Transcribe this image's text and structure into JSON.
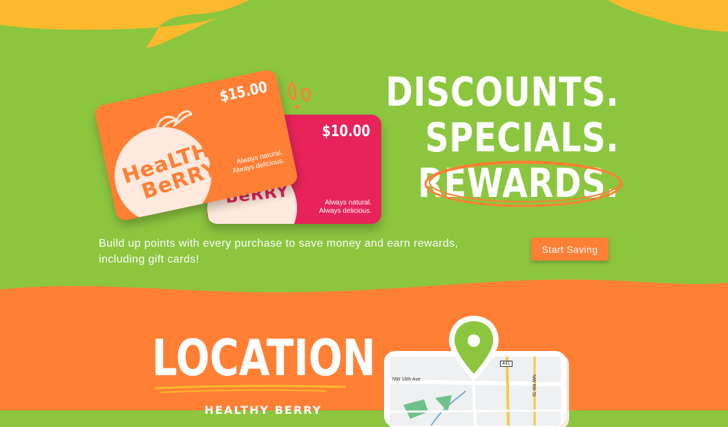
{
  "headline": {
    "line1": "DISCOUNTS.",
    "line2": "SPECIALS.",
    "line3": "REWARDS."
  },
  "cards": {
    "orange": {
      "amount": "$15.00",
      "tagline1": "Always natural.",
      "tagline2": "Always delicious.",
      "logo_line1": "HeaLTHY",
      "logo_line2": "BeRRY"
    },
    "pink": {
      "amount": "$10.00",
      "tagline1": "Always natural.",
      "tagline2": "Always delicious.",
      "logo_text": "BeRRY"
    }
  },
  "promo": {
    "text": "Build up points with every purchase to save money and earn rewards, including gift cards!",
    "button_label": "Start Saving"
  },
  "location": {
    "title": "LOCATION",
    "subtitle": "HEALTHY BERRY"
  },
  "map": {
    "road1": "NW 16th Ave",
    "road2": "NW 6th St",
    "highway": "441"
  },
  "colors": {
    "green": "#8cc63f",
    "orange": "#ff7f35",
    "pink": "#e8235a",
    "yellow": "#fdb92e",
    "cream": "#fde9dd"
  }
}
